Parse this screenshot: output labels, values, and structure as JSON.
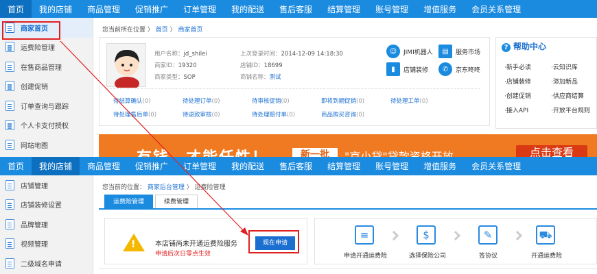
{
  "top": {
    "nav": [
      "首页",
      "我的店铺",
      "商品管理",
      "促销推广",
      "订单管理",
      "我的配送",
      "售后客服",
      "结算管理",
      "账号管理",
      "增值服务",
      "会员关系管理"
    ],
    "sidebar": [
      "商家首页",
      "运费险管理",
      "在售商品管理",
      "创建促销",
      "订单查询与跟踪",
      "个人卡支付授权",
      "网站地图"
    ],
    "breadcrumb": {
      "prefix": "您当前所在位置 〉",
      "home": "首页",
      "sep": "〉",
      "current": "商家首页"
    },
    "profile": {
      "username_label": "用户名称：",
      "username": "jd_shilei",
      "merchant_id_label": "商家ID：",
      "merchant_id": "19320",
      "merchant_type_label": "商家类型：",
      "merchant_type": "SOP",
      "last_login_label": "上次登录时间：",
      "last_login": "2014-12-09 14:18:30",
      "shop_id_label": "店铺ID：",
      "shop_id": "18699",
      "shop_name_label": "商铺名称：",
      "shop_name": "测试"
    },
    "services": [
      "JIMI机器人",
      "服务市场",
      "店铺装修",
      "京东咚咚"
    ],
    "task_links": [
      {
        "label": "待结算确认",
        "count": "(0)"
      },
      {
        "label": "待处理订单",
        "count": "(0)"
      },
      {
        "label": "待审核促销",
        "count": "(0)"
      },
      {
        "label": "即将到期促销",
        "count": "(0)"
      },
      {
        "label": "待处理工单",
        "count": "(0)"
      },
      {
        "label": "待处理售后单",
        "count": "(0)"
      },
      {
        "label": "待退款审核",
        "count": "(0)"
      },
      {
        "label": "待处理赔付单",
        "count": "(0)"
      },
      {
        "label": "商品购买咨询",
        "count": "(0)"
      }
    ],
    "help": {
      "title": "帮助中心",
      "links": [
        "·新手必读",
        "·云知识库",
        "·店铺装修",
        "·添加新品",
        "·创建促销",
        "·供应商结算",
        "·接入API",
        "·开放平台规则"
      ]
    },
    "banner": {
      "text": "有钱，才能任性！",
      "tag": "新一批",
      "sub": "\"京小贷\"贷款资格开放",
      "button": "点击查看"
    }
  },
  "bottom": {
    "nav": [
      "首页",
      "我的店铺",
      "商品管理",
      "促销推广",
      "订单管理",
      "我的配送",
      "售后客服",
      "结算管理",
      "账号管理",
      "增值服务",
      "会员关系管理"
    ],
    "sidebar": [
      "店铺管理",
      "店铺装修设置",
      "品牌管理",
      "视频管理",
      "二级域名申请"
    ],
    "breadcrumb": {
      "prefix": "您当前的位置：",
      "link": "商家后台管理",
      "sep": "〉",
      "current": "运费险管理"
    },
    "tabs": [
      "运费险管理",
      "续费管理"
    ],
    "notice": {
      "main": "本店铺尚未开通运费险服务",
      "sub": "申请后次日零点生效"
    },
    "apply_button": "现在申请",
    "steps": [
      "申请开通运费险",
      "选择保险公司",
      "签协议",
      "开通运费险"
    ]
  }
}
